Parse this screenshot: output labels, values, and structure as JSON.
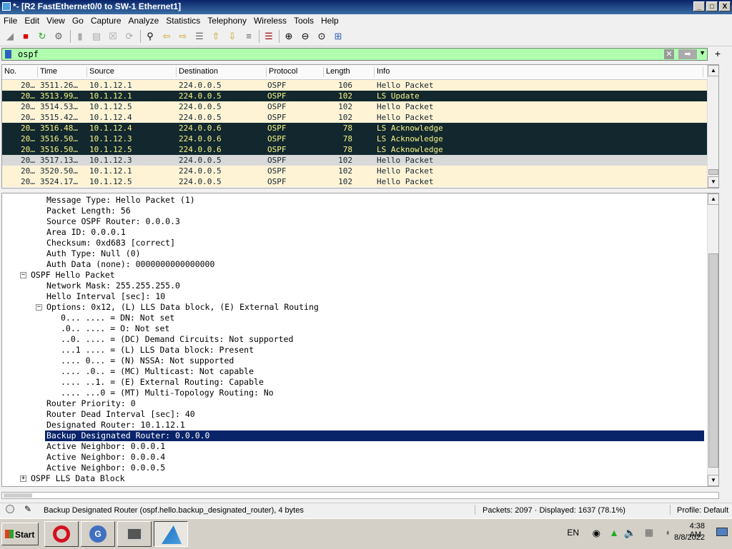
{
  "window": {
    "title": "*- [R2 FastEthernet0/0 to SW-1 Ethernet1]",
    "buttons": [
      "_",
      "□",
      "X"
    ]
  },
  "menu": [
    "File",
    "Edit",
    "View",
    "Go",
    "Capture",
    "Analyze",
    "Statistics",
    "Telephony",
    "Wireless",
    "Tools",
    "Help"
  ],
  "filter": {
    "value": "ospf",
    "clear_icon": "x-icon",
    "apply_icon": "arrow-right-icon",
    "add_label": "+",
    "background": "#afffaf"
  },
  "packet_list": {
    "columns": [
      "No.",
      "Time",
      "Source",
      "Destination",
      "Protocol",
      "Length",
      "Info"
    ],
    "rows": [
      {
        "no": "20…",
        "time": "3511.26…",
        "src": "10.1.12.1",
        "dst": "224.0.0.5",
        "proto": "OSPF",
        "len": "106",
        "info": "Hello Packet",
        "style": "hello"
      },
      {
        "no": "20…",
        "time": "3513.99…",
        "src": "10.1.12.1",
        "dst": "224.0.0.5",
        "proto": "OSPF",
        "len": "102",
        "info": "LS Update",
        "style": "lsa"
      },
      {
        "no": "20…",
        "time": "3514.53…",
        "src": "10.1.12.5",
        "dst": "224.0.0.5",
        "proto": "OSPF",
        "len": "102",
        "info": "Hello Packet",
        "style": "hello"
      },
      {
        "no": "20…",
        "time": "3515.42…",
        "src": "10.1.12.4",
        "dst": "224.0.0.5",
        "proto": "OSPF",
        "len": "102",
        "info": "Hello Packet",
        "style": "hello"
      },
      {
        "no": "20…",
        "time": "3516.48…",
        "src": "10.1.12.4",
        "dst": "224.0.0.6",
        "proto": "OSPF",
        "len": "78",
        "info": "LS Acknowledge",
        "style": "lsa"
      },
      {
        "no": "20…",
        "time": "3516.50…",
        "src": "10.1.12.3",
        "dst": "224.0.0.6",
        "proto": "OSPF",
        "len": "78",
        "info": "LS Acknowledge",
        "style": "lsa"
      },
      {
        "no": "20…",
        "time": "3516.50…",
        "src": "10.1.12.5",
        "dst": "224.0.0.6",
        "proto": "OSPF",
        "len": "78",
        "info": "LS Acknowledge",
        "style": "lsa"
      },
      {
        "no": "20…",
        "time": "3517.13…",
        "src": "10.1.12.3",
        "dst": "224.0.0.5",
        "proto": "OSPF",
        "len": "102",
        "info": "Hello Packet",
        "style": "sel"
      },
      {
        "no": "20…",
        "time": "3520.50…",
        "src": "10.1.12.1",
        "dst": "224.0.0.5",
        "proto": "OSPF",
        "len": "102",
        "info": "Hello Packet",
        "style": "hello"
      },
      {
        "no": "20…",
        "time": "3524.17…",
        "src": "10.1.12.5",
        "dst": "224.0.0.5",
        "proto": "OSPF",
        "len": "102",
        "info": "Hello Packet",
        "style": "hello"
      }
    ]
  },
  "details": [
    {
      "text": "Message Type: Hello Packet (1)",
      "indent": 2
    },
    {
      "text": "Packet Length: 56",
      "indent": 2
    },
    {
      "text": "Source OSPF Router: 0.0.0.3",
      "indent": 2
    },
    {
      "text": "Area ID: 0.0.0.1",
      "indent": 2
    },
    {
      "text": "Checksum: 0xd683 [correct]",
      "indent": 2
    },
    {
      "text": "Auth Type: Null (0)",
      "indent": 2
    },
    {
      "text": "Auth Data (none): 0000000000000000",
      "indent": 2
    },
    {
      "text": "OSPF Hello Packet",
      "indent": 1,
      "toggle": "−"
    },
    {
      "text": "Network Mask: 255.255.255.0",
      "indent": 2
    },
    {
      "text": "Hello Interval [sec]: 10",
      "indent": 2
    },
    {
      "text": "Options: 0x12, (L) LLS Data block, (E) External Routing",
      "indent": 2,
      "toggle": "−"
    },
    {
      "text": "0... .... = DN: Not set",
      "indent": 3
    },
    {
      "text": ".0.. .... = O: Not set",
      "indent": 3
    },
    {
      "text": "..0. .... = (DC) Demand Circuits: Not supported",
      "indent": 3
    },
    {
      "text": "...1 .... = (L) LLS Data block: Present",
      "indent": 3
    },
    {
      "text": ".... 0... = (N) NSSA: Not supported",
      "indent": 3
    },
    {
      "text": ".... .0.. = (MC) Multicast: Not capable",
      "indent": 3
    },
    {
      "text": ".... ..1. = (E) External Routing: Capable",
      "indent": 3
    },
    {
      "text": ".... ...0 = (MT) Multi-Topology Routing: No",
      "indent": 3
    },
    {
      "text": "Router Priority: 0",
      "indent": 2
    },
    {
      "text": "Router Dead Interval [sec]: 40",
      "indent": 2
    },
    {
      "text": "Designated Router: 10.1.12.1",
      "indent": 2
    },
    {
      "text": "Backup Designated Router: 0.0.0.0",
      "indent": 2,
      "selected": true
    },
    {
      "text": "Active Neighbor: 0.0.0.1",
      "indent": 2
    },
    {
      "text": "Active Neighbor: 0.0.0.4",
      "indent": 2
    },
    {
      "text": "Active Neighbor: 0.0.0.5",
      "indent": 2
    },
    {
      "text": "OSPF LLS Data Block",
      "indent": 1,
      "toggle": "+"
    }
  ],
  "status": {
    "field": "Backup Designated Router (ospf.hello.backup_designated_router), 4 bytes",
    "packets": "Packets: 2097 · Displayed: 1637 (78.1%)",
    "profile": "Profile: Default"
  },
  "taskbar": {
    "start": "Start",
    "lang": "EN",
    "time": "4:38 AM",
    "date": "8/8/2022"
  },
  "colors": {
    "hello_bg": "#fff3d6",
    "lsa_bg": "#12272e",
    "lsa_fg": "#f7f787",
    "selected_bg": "#0a246a"
  }
}
